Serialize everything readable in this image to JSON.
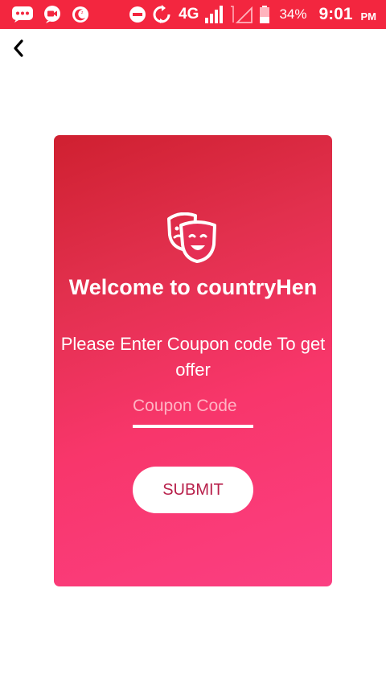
{
  "status_bar": {
    "left_icons": [
      "message-icon",
      "video-icon",
      "sleep-mode-icon"
    ],
    "network_label": "4G",
    "battery_percent": "34%",
    "time": "9:01",
    "am_pm": "PM",
    "background_color": "#f3263f"
  },
  "toolbar": {
    "back_icon": "chevron-left-icon"
  },
  "card": {
    "icon": "theater-masks-icon",
    "title": "Welcome to countryHen",
    "subtitle": "Please Enter Coupon code To get offer",
    "coupon_placeholder": "Coupon Code",
    "coupon_value": "",
    "submit_label": "SUBMIT",
    "gradient_start": "#cf2030",
    "gradient_end": "#fb3f82"
  }
}
